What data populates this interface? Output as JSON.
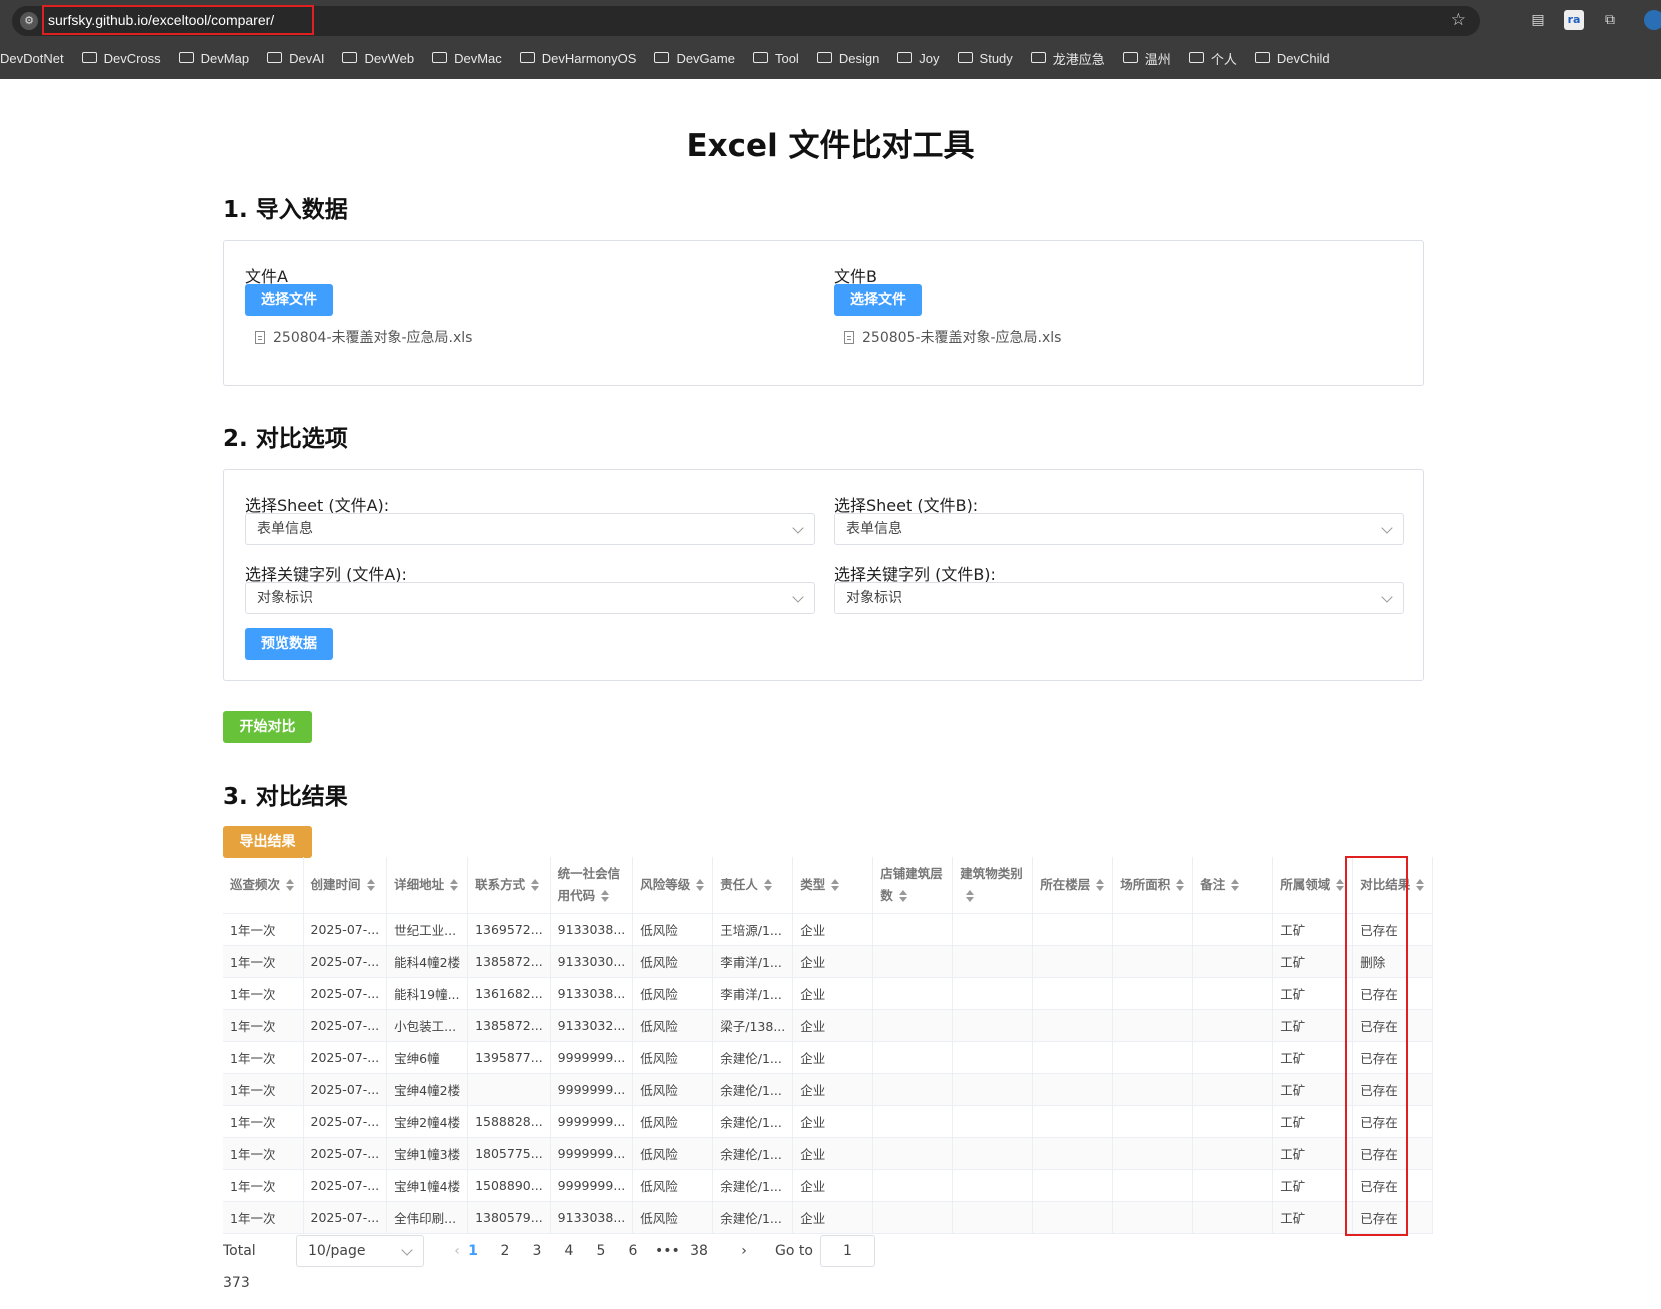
{
  "browser": {
    "url": "surfsky.github.io/exceltool/comparer/",
    "bookmarks": [
      "DevDotNet",
      "DevCross",
      "DevMap",
      "DevAI",
      "DevWeb",
      "DevMac",
      "DevHarmonyOS",
      "DevGame",
      "Tool",
      "Design",
      "Joy",
      "Study",
      "龙港应急",
      "温州",
      "个人",
      "DevChild"
    ]
  },
  "page": {
    "title": "Excel 文件比对工具"
  },
  "import": {
    "title": "1. 导入数据",
    "file_a_label": "文件A",
    "file_b_label": "文件B",
    "choose_label": "选择文件",
    "file_a_name": "250804-未覆盖对象-应急局.xls",
    "file_b_name": "250805-未覆盖对象-应急局.xls"
  },
  "options": {
    "title": "2. 对比选项",
    "sheet_a_label": "选择Sheet (文件A):",
    "sheet_b_label": "选择Sheet (文件B):",
    "sheet_a_value": "表单信息",
    "sheet_b_value": "表单信息",
    "key_a_label": "选择关键字列 (文件A):",
    "key_b_label": "选择关键字列 (文件B):",
    "key_a_value": "对象标识",
    "key_b_value": "对象标识",
    "preview_label": "预览数据"
  },
  "start_label": "开始对比",
  "results": {
    "title": "3. 对比结果",
    "export_label": "导出结果",
    "columns": [
      "巡查频次",
      "创建时间",
      "详细地址",
      "联系方式",
      "统一社会信用代码",
      "风险等级",
      "责任人",
      "类型",
      "店铺建筑层数",
      "建筑物类别",
      "所在楼层",
      "场所面积",
      "备注",
      "所属领域",
      "对比结果"
    ],
    "rows": [
      [
        "1年一次",
        "2025-07-...",
        "世纪工业...",
        "1369572...",
        "9133038...",
        "低风险",
        "王培源/1...",
        "企业",
        "",
        "",
        "",
        "",
        "",
        "工矿",
        "已存在"
      ],
      [
        "1年一次",
        "2025-07-...",
        "能科4幢2楼",
        "1385872...",
        "9133030...",
        "低风险",
        "李甫洋/1...",
        "企业",
        "",
        "",
        "",
        "",
        "",
        "工矿",
        "删除"
      ],
      [
        "1年一次",
        "2025-07-...",
        "能科19幢...",
        "1361682...",
        "9133038...",
        "低风险",
        "李甫洋/1...",
        "企业",
        "",
        "",
        "",
        "",
        "",
        "工矿",
        "已存在"
      ],
      [
        "1年一次",
        "2025-07-...",
        "小包装工...",
        "1385872...",
        "9133032...",
        "低风险",
        "梁子/138...",
        "企业",
        "",
        "",
        "",
        "",
        "",
        "工矿",
        "已存在"
      ],
      [
        "1年一次",
        "2025-07-...",
        "宝绅6幢",
        "1395877...",
        "9999999...",
        "低风险",
        "余建伦/1...",
        "企业",
        "",
        "",
        "",
        "",
        "",
        "工矿",
        "已存在"
      ],
      [
        "1年一次",
        "2025-07-...",
        "宝绅4幢2楼",
        "",
        "9999999...",
        "低风险",
        "余建伦/1...",
        "企业",
        "",
        "",
        "",
        "",
        "",
        "工矿",
        "已存在"
      ],
      [
        "1年一次",
        "2025-07-...",
        "宝绅2幢4楼",
        "1588828...",
        "9999999...",
        "低风险",
        "余建伦/1...",
        "企业",
        "",
        "",
        "",
        "",
        "",
        "工矿",
        "已存在"
      ],
      [
        "1年一次",
        "2025-07-...",
        "宝绅1幢3楼",
        "1805775...",
        "9999999...",
        "低风险",
        "余建伦/1...",
        "企业",
        "",
        "",
        "",
        "",
        "",
        "工矿",
        "已存在"
      ],
      [
        "1年一次",
        "2025-07-...",
        "宝绅1幢4楼",
        "1508890...",
        "9999999...",
        "低风险",
        "余建伦/1...",
        "企业",
        "",
        "",
        "",
        "",
        "",
        "工矿",
        "已存在"
      ],
      [
        "1年一次",
        "2025-07-...",
        "全伟印刷...",
        "1380579...",
        "9133038...",
        "低风险",
        "余建伦/1...",
        "企业",
        "",
        "",
        "",
        "",
        "",
        "工矿",
        "已存在"
      ]
    ]
  },
  "pagination": {
    "total": "Total 373",
    "page_size": "10/page",
    "pages": [
      "1",
      "2",
      "3",
      "4",
      "5",
      "6",
      "•••",
      "38"
    ],
    "current": "1",
    "goto_label": "Go to",
    "goto_value": "1"
  }
}
